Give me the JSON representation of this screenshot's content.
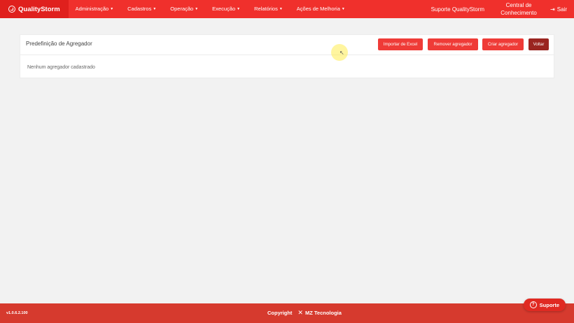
{
  "brand": {
    "name": "QualityStorm",
    "icon": "qualitystorm-logo-icon"
  },
  "nav": {
    "items": [
      {
        "label": "Administração"
      },
      {
        "label": "Cadastros"
      },
      {
        "label": "Operação"
      },
      {
        "label": "Execução"
      },
      {
        "label": "Relatórios"
      },
      {
        "label": "Ações de Melhoria"
      }
    ],
    "support_label": "Suporte QualityStorm",
    "knowledge_line1": "Central de",
    "knowledge_line2": "Conhecimento",
    "logout_label": "Sair"
  },
  "panel": {
    "title": "Predefinição de Agregador",
    "buttons": {
      "import": "Importar de Excel",
      "remove": "Remover agregador",
      "create": "Criar agregador",
      "back": "Voltar"
    },
    "empty_message": "Nenhum agregador cadastrado"
  },
  "footer": {
    "version": "v1.0.6.2.100",
    "copyright": "Copyright",
    "company": "MZ Tecnologia",
    "support_button": "Suporte"
  },
  "colors": {
    "navbar": "#f0302c",
    "primary_button": "#ef3b37",
    "back_button": "#9a2520",
    "footer": "#d63a2e"
  }
}
